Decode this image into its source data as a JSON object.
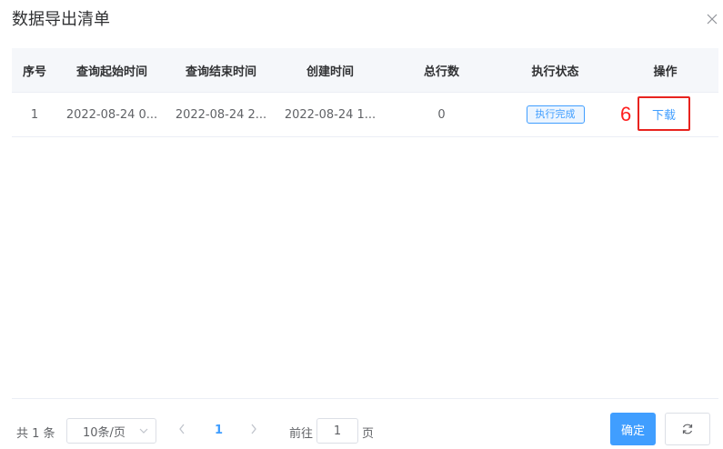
{
  "dialog": {
    "title": "数据导出清单"
  },
  "table": {
    "columns": [
      "序号",
      "查询起始时间",
      "查询结束时间",
      "创建时间",
      "总行数",
      "执行状态",
      "操作"
    ],
    "rows": [
      {
        "index": "1",
        "query_start": "2022-08-24 0...",
        "query_end": "2022-08-24 2...",
        "created": "2022-08-24 1...",
        "total_rows": "0",
        "status": "执行完成",
        "action": "下载"
      }
    ]
  },
  "annotation": {
    "step_number": "6",
    "color": "#ff1f1f"
  },
  "pagination": {
    "total_text": "共 1 条",
    "page_size": "10条/页",
    "current_page": "1",
    "goto_label": "前往",
    "goto_value": "1",
    "goto_suffix": "页"
  },
  "footer": {
    "confirm_label": "确定"
  },
  "colors": {
    "accent": "#409eff",
    "header_bg": "#f5f7fa",
    "annotation_red": "#e8231f"
  },
  "icons": {
    "close": "close-icon",
    "prev": "chevron-left-icon",
    "next": "chevron-right-icon",
    "refresh": "refresh-icon",
    "select": "chevron-down-icon"
  }
}
